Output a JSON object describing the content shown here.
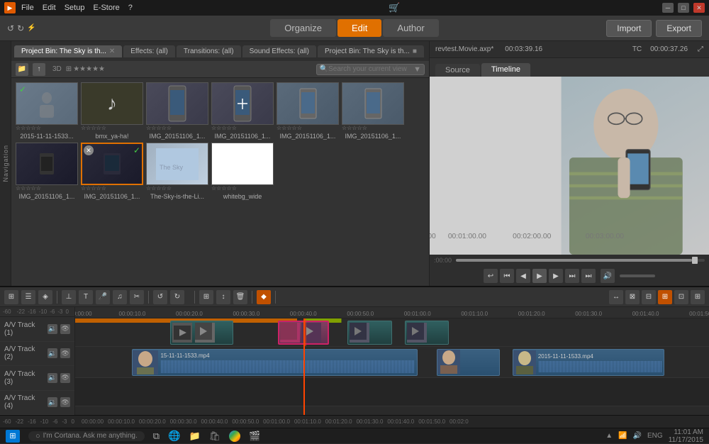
{
  "titlebar": {
    "menus": [
      "File",
      "Edit",
      "Setup",
      "E-Store",
      "?"
    ],
    "win_min": "─",
    "win_max": "□",
    "win_close": "✕"
  },
  "top_nav": {
    "tabs": [
      "Organize",
      "Edit",
      "Author"
    ],
    "active": "Edit",
    "import_label": "Import",
    "export_label": "Export"
  },
  "media_tabs": [
    {
      "label": "Project Bin: The Sky is th...",
      "closable": true
    },
    {
      "label": "Effects: (all)",
      "closable": false
    },
    {
      "label": "Transitions: (all)",
      "closable": false
    },
    {
      "label": "Sound Effects: (all)",
      "closable": false
    },
    {
      "label": "Project Bin: The Sky is th...",
      "closable": true
    }
  ],
  "media_items": [
    {
      "label": "2015-11-11-1533...",
      "type": "photo",
      "checked": true
    },
    {
      "label": "bmx_ya-ha!",
      "type": "music"
    },
    {
      "label": "IMG_20151106_1...",
      "type": "phone"
    },
    {
      "label": "IMG_20151106_1...",
      "type": "phone"
    },
    {
      "label": "IMG_20151106_1...",
      "type": "phone"
    },
    {
      "label": "IMG_20151106_1...",
      "type": "phone"
    },
    {
      "label": "IMG_20151106_1...",
      "type": "dark",
      "selected": true
    },
    {
      "label": "IMG_20151106_1...",
      "type": "dark2",
      "checked": true
    },
    {
      "label": "The-Sky-is-the-Li...",
      "type": "bluegrad"
    },
    {
      "label": "whitebg_wide",
      "type": "white"
    }
  ],
  "search_placeholder": "Search your current view",
  "preview": {
    "filename": "revtest.Movie.axp*",
    "duration": "00:03:39.16",
    "tc_label": "TC",
    "timecode": "00:00:37.26",
    "tabs": [
      "Source",
      "Timeline"
    ],
    "active_tab": "Timeline",
    "time_start": ":00:00",
    "time_1m": "00:01:00.00",
    "time_2m": "00:02:00.00",
    "time_3m": "00:03:00.00"
  },
  "timeline": {
    "tracks": [
      {
        "name": "A/V Track (1)",
        "number": 1
      },
      {
        "name": "A/V Track (2)",
        "number": 2
      },
      {
        "name": "A/V Track (3)",
        "number": 3
      },
      {
        "name": "A/V Track (4)",
        "number": 4
      }
    ],
    "ruler_marks": [
      "-60",
      "-22",
      "-16",
      "-10",
      "-6",
      "-3",
      "0"
    ],
    "time_marks": [
      "00:00:00",
      "00:00:10.0",
      "00:00:20.0",
      "00:00:30.0",
      "00:00:40.0",
      "00:00:50.0",
      "00:01:00.0",
      "00:01:10.0",
      "00:01:20.0",
      "00:01:30.0",
      "00:01:40.0",
      "00:01:50.0",
      "00:02:0"
    ],
    "clip_av2_label": "15-11-11-1533.mp4",
    "clip_av2_label2": "2015-11-11-1533.mp4"
  },
  "statusbar": {
    "cortana_text": "I'm Cortana. Ask me anything.",
    "time": "11:01 AM",
    "date": "11/17/2015",
    "lang": "ENG"
  }
}
